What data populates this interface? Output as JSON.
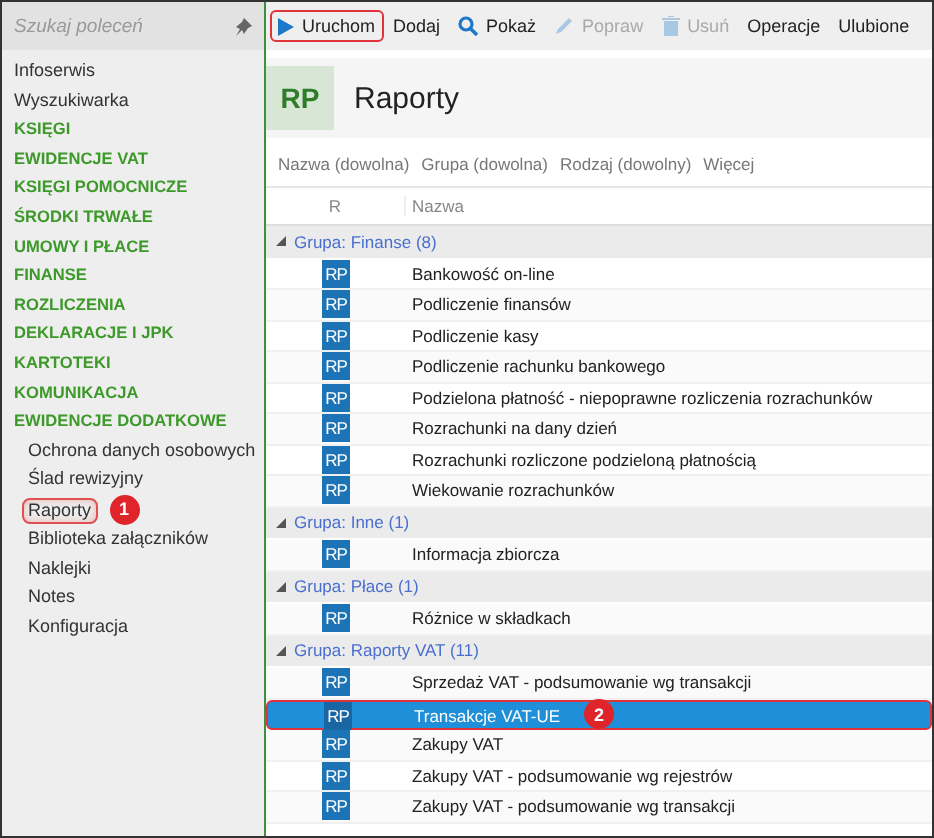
{
  "sidebar": {
    "search": {
      "placeholder": "Szukaj poleceń"
    },
    "items": [
      {
        "label": "Infoserwis",
        "kind": "link",
        "selected": false
      },
      {
        "label": "Wyszukiwarka",
        "kind": "link",
        "selected": false
      },
      {
        "label": "KSIĘGI",
        "kind": "section",
        "selected": false
      },
      {
        "label": "EWIDENCJE VAT",
        "kind": "section",
        "selected": false
      },
      {
        "label": "KSIĘGI POMOCNICZE",
        "kind": "section",
        "selected": false
      },
      {
        "label": "ŚRODKI TRWAŁE",
        "kind": "section",
        "selected": false
      },
      {
        "label": "UMOWY I PŁACE",
        "kind": "section",
        "selected": false
      },
      {
        "label": "FINANSE",
        "kind": "section",
        "selected": false
      },
      {
        "label": "ROZLICZENIA",
        "kind": "section",
        "selected": false
      },
      {
        "label": "DEKLARACJE I JPK",
        "kind": "section",
        "selected": false
      },
      {
        "label": "KARTOTEKI",
        "kind": "section",
        "selected": false
      },
      {
        "label": "KOMUNIKACJA",
        "kind": "section",
        "selected": false
      },
      {
        "label": "EWIDENCJE DODATKOWE",
        "kind": "section",
        "selected": false,
        "children": [
          {
            "label": "Ochrona danych osobowych",
            "kind": "link",
            "selected": false
          },
          {
            "label": "Ślad rewizyjny",
            "kind": "link",
            "selected": false
          },
          {
            "label": "Raporty",
            "kind": "link",
            "selected": true,
            "callout": "1"
          },
          {
            "label": "Biblioteka załączników",
            "kind": "link",
            "selected": false
          },
          {
            "label": "Naklejki",
            "kind": "link",
            "selected": false
          },
          {
            "label": "Notes",
            "kind": "link",
            "selected": false
          },
          {
            "label": "Konfiguracja",
            "kind": "link",
            "selected": false
          }
        ]
      }
    ]
  },
  "toolbar": [
    {
      "label": "Uruchom",
      "kind": "run",
      "disabled": false,
      "highlighted": true
    },
    {
      "label": "Dodaj",
      "kind": "plain",
      "disabled": false,
      "highlighted": false
    },
    {
      "label": "Pokaż",
      "kind": "show",
      "disabled": false,
      "highlighted": false
    },
    {
      "label": "Popraw",
      "kind": "edit",
      "disabled": true,
      "highlighted": false
    },
    {
      "label": "Usuń",
      "kind": "delete",
      "disabled": true,
      "highlighted": false
    },
    {
      "label": "Operacje",
      "kind": "plain",
      "disabled": false,
      "highlighted": false
    },
    {
      "label": "Ulubione",
      "kind": "plain",
      "disabled": false,
      "highlighted": false
    }
  ],
  "header": {
    "badge": "RP",
    "title": "Raporty"
  },
  "filters": [
    "Nazwa (dowolna)",
    "Grupa (dowolna)",
    "Rodzaj (dowolny)",
    "Więcej"
  ],
  "table": {
    "columns": [
      "R",
      "Nazwa"
    ],
    "groups": [
      {
        "label": "Grupa: Finanse (8)",
        "expanded": true,
        "rows": [
          {
            "badge": "RP",
            "name": "Bankowość on-line",
            "selected": false
          },
          {
            "badge": "RP",
            "name": "Podliczenie finansów",
            "selected": false
          },
          {
            "badge": "RP",
            "name": "Podliczenie kasy",
            "selected": false
          },
          {
            "badge": "RP",
            "name": "Podliczenie rachunku bankowego",
            "selected": false
          },
          {
            "badge": "RP",
            "name": "Podzielona płatność - niepoprawne rozliczenia rozrachunków",
            "selected": false
          },
          {
            "badge": "RP",
            "name": "Rozrachunki na dany dzień",
            "selected": false
          },
          {
            "badge": "RP",
            "name": "Rozrachunki rozliczone podzieloną płatnością",
            "selected": false
          },
          {
            "badge": "RP",
            "name": "Wiekowanie rozrachunków",
            "selected": false
          }
        ]
      },
      {
        "label": "Grupa: Inne (1)",
        "expanded": true,
        "rows": [
          {
            "badge": "RP",
            "name": "Informacja zbiorcza",
            "selected": false
          }
        ]
      },
      {
        "label": "Grupa: Płace (1)",
        "expanded": true,
        "rows": [
          {
            "badge": "RP",
            "name": "Różnice w składkach",
            "selected": false
          }
        ]
      },
      {
        "label": "Grupa: Raporty VAT (11)",
        "expanded": true,
        "rows": [
          {
            "badge": "RP",
            "name": "Sprzedaż VAT - podsumowanie wg transakcji",
            "selected": false
          },
          {
            "badge": "RP",
            "name": "Transakcje VAT-UE",
            "selected": true,
            "callout": "2"
          },
          {
            "badge": "RP",
            "name": "Zakupy VAT",
            "selected": false
          },
          {
            "badge": "RP",
            "name": "Zakupy VAT - podsumowanie wg rejestrów",
            "selected": false
          },
          {
            "badge": "RP",
            "name": "Zakupy VAT - podsumowanie wg transakcji",
            "selected": false
          }
        ]
      }
    ]
  }
}
